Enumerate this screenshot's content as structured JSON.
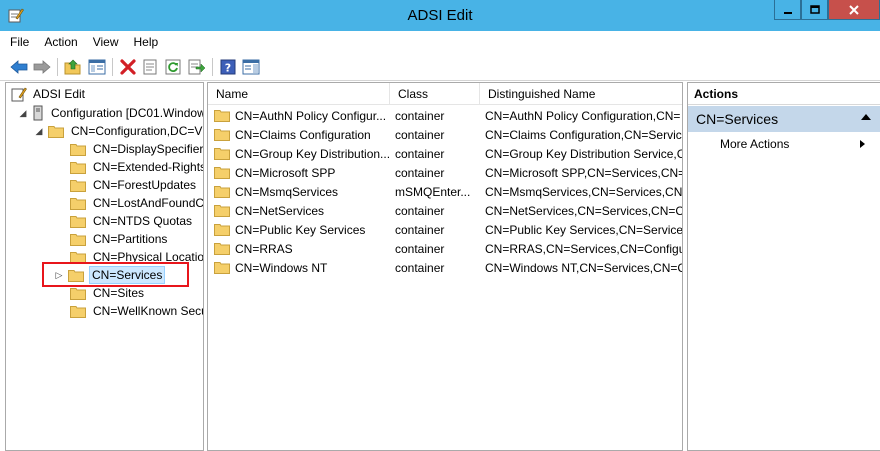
{
  "window": {
    "title": "ADSI Edit"
  },
  "menu": [
    "File",
    "Action",
    "View",
    "Help"
  ],
  "toolbar": {
    "buttons": [
      "back-icon",
      "forward-icon",
      "up-folder-icon",
      "show-hide-tree-icon",
      "delete-icon",
      "properties-icon",
      "refresh-icon",
      "export-list-icon",
      "help-icon",
      "show-hide-action-pane-icon"
    ]
  },
  "tree": {
    "root": "ADSI Edit",
    "connection": "Configuration [DC01.Window",
    "config": "CN=Configuration,DC=V",
    "children": [
      "CN=DisplaySpecifiers",
      "CN=Extended-Rights",
      "CN=ForestUpdates",
      "CN=LostAndFoundC",
      "CN=NTDS Quotas",
      "CN=Partitions",
      "CN=Physical Locatio",
      "CN=Services",
      "CN=Sites",
      "CN=WellKnown Secu"
    ],
    "selected": "CN=Services"
  },
  "list": {
    "columns": [
      "Name",
      "Class",
      "Distinguished Name"
    ],
    "rows": [
      {
        "name": "CN=AuthN Policy Configur...",
        "class": "container",
        "dn": "CN=AuthN Policy Configuration,CN="
      },
      {
        "name": "CN=Claims Configuration",
        "class": "container",
        "dn": "CN=Claims Configuration,CN=Servic"
      },
      {
        "name": "CN=Group Key Distribution...",
        "class": "container",
        "dn": "CN=Group Key Distribution Service,C"
      },
      {
        "name": "CN=Microsoft SPP",
        "class": "container",
        "dn": "CN=Microsoft SPP,CN=Services,CN="
      },
      {
        "name": "CN=MsmqServices",
        "class": "mSMQEnter...",
        "dn": "CN=MsmqServices,CN=Services,CN="
      },
      {
        "name": "CN=NetServices",
        "class": "container",
        "dn": "CN=NetServices,CN=Services,CN=Co"
      },
      {
        "name": "CN=Public Key Services",
        "class": "container",
        "dn": "CN=Public Key Services,CN=Services,"
      },
      {
        "name": "CN=RRAS",
        "class": "container",
        "dn": "CN=RRAS,CN=Services,CN=Configur"
      },
      {
        "name": "CN=Windows NT",
        "class": "container",
        "dn": "CN=Windows NT,CN=Services,CN=C"
      }
    ]
  },
  "actions": {
    "header": "Actions",
    "section": "CN=Services",
    "items": [
      "More Actions"
    ]
  },
  "colors": {
    "titlebar": "#48b3e6",
    "close_button": "#c7504b",
    "actions_section": "#c4d7ea",
    "highlight_box": "#e8151b",
    "folder": "#f5cf6a"
  }
}
